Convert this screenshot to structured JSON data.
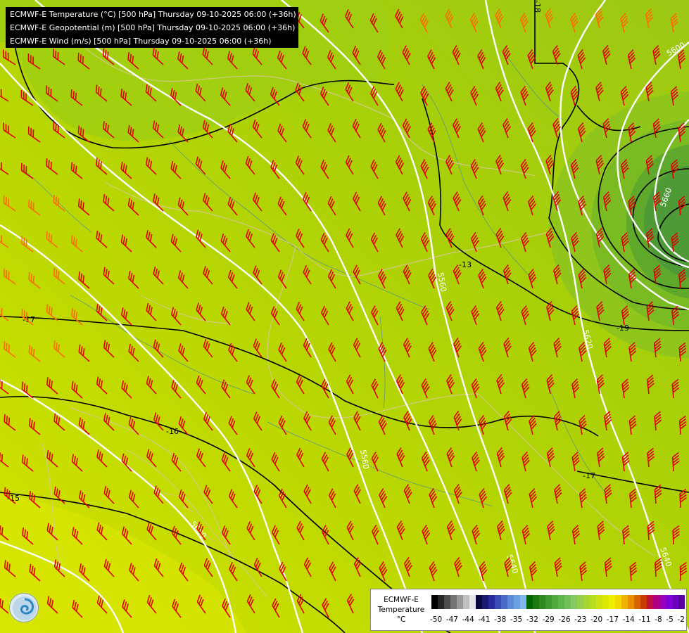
{
  "header": {
    "line1": "ECMWF-E Temperature (°C) [500 hPa] Thursday 09-10-2025 06:00 (+36h)",
    "line2": "ECMWF-E Geopotential (m) [500 hPa] Thursday 09-10-2025 06:00 (+36h)",
    "line3": "ECMWF-E Wind (m/s) [500 hPa] Thursday 09-10-2025 06:00 (+36h)"
  },
  "legend": {
    "title_line1": "ECMWF-E",
    "title_line2": "Temperature",
    "unit": "°C",
    "ticks": [
      "-50",
      "-47",
      "-44",
      "-41",
      "-38",
      "-35",
      "-32",
      "-29",
      "-26",
      "-23",
      "-20",
      "-17",
      "-14",
      "-11",
      "-8",
      "-5",
      "-2"
    ],
    "colors": [
      "#000000",
      "#262626",
      "#4d4d4d",
      "#737373",
      "#999999",
      "#bfbfbf",
      "#e6e6e6",
      "#0a0a40",
      "#1a1a70",
      "#2a2aa0",
      "#3a4ab8",
      "#4a6ac8",
      "#5a8ad8",
      "#6aa0e0",
      "#80b8ee",
      "#006400",
      "#1a7a10",
      "#2e8a20",
      "#3e9a2e",
      "#4ea83c",
      "#5eb64a",
      "#70c058",
      "#84ca60",
      "#96d04a",
      "#a6d632",
      "#b8dc1e",
      "#cae010",
      "#dce600",
      "#eeee00",
      "#f2d800",
      "#f0b400",
      "#e89000",
      "#d86400",
      "#c83c00",
      "#c01040",
      "#b00080",
      "#9a00b8",
      "#8200d8",
      "#6a00c0",
      "#5a00a0"
    ]
  },
  "map": {
    "geopotential_labels": [
      "5600",
      "5600",
      "5560",
      "5620",
      "5560",
      "5640",
      "5640",
      "5680",
      "5660"
    ],
    "temperature_labels": [
      "-17",
      "-16",
      "-15",
      "-13",
      "-19",
      "-17",
      "-18"
    ],
    "logo_icon": "ecmwf-logo-icon"
  }
}
